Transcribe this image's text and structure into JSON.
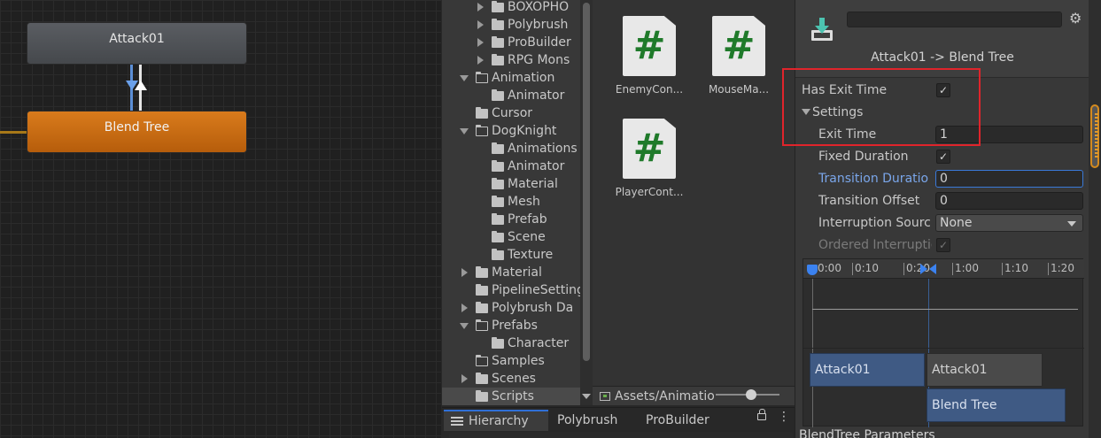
{
  "graph": {
    "nodes": {
      "attack": "Attack01",
      "blend": "Blend Tree"
    }
  },
  "project_tree": {
    "rows": [
      {
        "label": "BOXOPHO",
        "indent": 2,
        "caret": "closed",
        "folder": "closed",
        "selected": false
      },
      {
        "label": "Polybrush",
        "indent": 2,
        "caret": "closed",
        "folder": "closed",
        "selected": false
      },
      {
        "label": "ProBuilder",
        "indent": 2,
        "caret": "closed",
        "folder": "closed",
        "selected": false
      },
      {
        "label": "RPG Mons",
        "indent": 2,
        "caret": "closed",
        "folder": "closed",
        "selected": false
      },
      {
        "label": "Animation",
        "indent": 1,
        "caret": "open",
        "folder": "open",
        "selected": false
      },
      {
        "label": "Animator",
        "indent": 2,
        "caret": "none",
        "folder": "closed",
        "selected": false
      },
      {
        "label": "Cursor",
        "indent": 1,
        "caret": "none",
        "folder": "closed",
        "selected": false
      },
      {
        "label": "DogKnight",
        "indent": 1,
        "caret": "open",
        "folder": "open",
        "selected": false
      },
      {
        "label": "Animations",
        "indent": 2,
        "caret": "none",
        "folder": "closed",
        "selected": false
      },
      {
        "label": "Animator",
        "indent": 2,
        "caret": "none",
        "folder": "closed",
        "selected": false
      },
      {
        "label": "Material",
        "indent": 2,
        "caret": "none",
        "folder": "closed",
        "selected": false
      },
      {
        "label": "Mesh",
        "indent": 2,
        "caret": "none",
        "folder": "closed",
        "selected": false
      },
      {
        "label": "Prefab",
        "indent": 2,
        "caret": "none",
        "folder": "closed",
        "selected": false
      },
      {
        "label": "Scene",
        "indent": 2,
        "caret": "none",
        "folder": "closed",
        "selected": false
      },
      {
        "label": "Texture",
        "indent": 2,
        "caret": "none",
        "folder": "closed",
        "selected": false
      },
      {
        "label": "Material",
        "indent": 1,
        "caret": "closed",
        "folder": "closed",
        "selected": false
      },
      {
        "label": "PipelineSettings",
        "indent": 1,
        "caret": "none",
        "folder": "closed",
        "selected": false
      },
      {
        "label": "Polybrush Da",
        "indent": 1,
        "caret": "closed",
        "folder": "closed",
        "selected": false
      },
      {
        "label": "Prefabs",
        "indent": 1,
        "caret": "open",
        "folder": "open",
        "selected": false
      },
      {
        "label": "Character",
        "indent": 2,
        "caret": "none",
        "folder": "closed",
        "selected": false
      },
      {
        "label": "Samples",
        "indent": 1,
        "caret": "none",
        "folder": "outline",
        "selected": false
      },
      {
        "label": "Scenes",
        "indent": 1,
        "caret": "closed",
        "folder": "closed",
        "selected": false
      },
      {
        "label": "Scripts",
        "indent": 1,
        "caret": "none",
        "folder": "closed",
        "selected": true
      }
    ]
  },
  "assets": {
    "icon_glyph": "#",
    "items": [
      {
        "name": "EnemyCon..."
      },
      {
        "name": "MouseMa..."
      },
      {
        "name": "PlayerCont..."
      }
    ],
    "path": "Assets/Animatio",
    "path_icon": "folder-path-icon"
  },
  "bottom_tabs": {
    "hierarchy": "Hierarchy",
    "polybrush": "Polybrush",
    "probuilder": "ProBuilder",
    "kebab": "⋮"
  },
  "inspector": {
    "title": "Attack01 -> Blend Tree",
    "gear": "⚙",
    "has_exit_time_label": "Has Exit Time",
    "has_exit_time_checked": "✓",
    "settings_label": "Settings",
    "exit_time_label": "Exit Time",
    "exit_time_value": "1",
    "fixed_duration_label": "Fixed Duration",
    "fixed_duration_checked": "✓",
    "transition_duration_label": "Transition Duratio",
    "transition_duration_value": "0",
    "transition_offset_label": "Transition Offset",
    "transition_offset_value": "0",
    "interruption_source_label": "Interruption Sourc",
    "interruption_source_value": "None",
    "ordered_interruption_label": "Ordered Interruptic",
    "ordered_interruption_checked": "✓",
    "timeline": {
      "ticks": [
        "0:00",
        "0:10",
        "0:20",
        "1:00",
        "1:10",
        "1:20"
      ],
      "clip_source": "Attack01",
      "clip_dest_top": "Attack01",
      "clip_dest_bottom": "Blend Tree"
    },
    "blend_params_label": "BlendTree Parameters"
  },
  "colors": {
    "accent_blue": "#3b82f0",
    "highlight_red": "#e0242b",
    "blend_orange": "#d97b1c",
    "script_green": "#1f7a2a"
  }
}
